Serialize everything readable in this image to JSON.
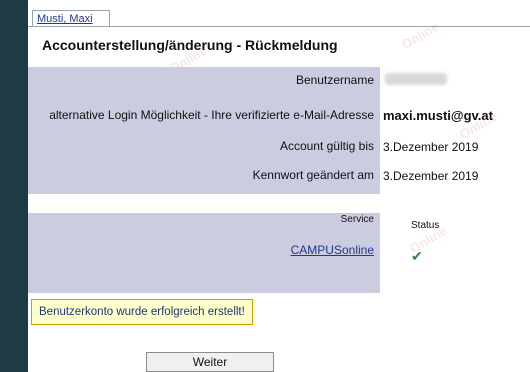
{
  "tab": {
    "label": "Musti, Maxi"
  },
  "title": "Accounterstellung/änderung - Rückmeldung",
  "fields": [
    {
      "label": "Benutzername",
      "value": ""
    },
    {
      "label": "alternative Login Möglichkeit - Ihre verifizierte e-Mail-Adresse",
      "value": "maxi.musti@gv.at"
    },
    {
      "label": "Account gültig bis",
      "value": "3.Dezember 2019"
    },
    {
      "label": "Kennwort geändert am",
      "value": "3.Dezember 2019"
    }
  ],
  "services": {
    "service_header": "Service",
    "status_header": "Status",
    "service_name": "CAMPUSonline",
    "status_icon": "check-icon"
  },
  "message": "Benutzerkonto wurde erfolgreich erstellt!",
  "continue_label": "Weiter",
  "colors": {
    "panel": "#cccce0",
    "success_bg": "#ffffcc",
    "success_border": "#d4a000",
    "check": "#2e8b2e",
    "outer_bg": "#1e3a44"
  }
}
